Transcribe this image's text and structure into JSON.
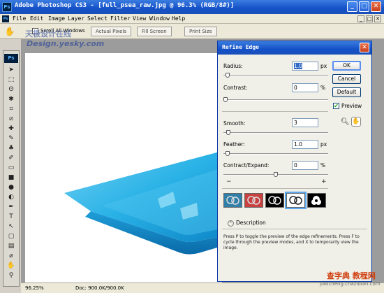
{
  "window": {
    "title": "Adobe Photoshop CS3 - [full_psea_raw.jpg @ 96.3% (RGB/8#)]",
    "app_badge": "Ps",
    "min": "_",
    "max": "□",
    "close": "✕"
  },
  "menu": {
    "items": [
      "File",
      "Edit",
      "Image",
      "Layer",
      "Select",
      "Filter",
      "View",
      "Window",
      "Help"
    ]
  },
  "options_bar": {
    "tool_icon": "hand-icon",
    "scroll_all_windows": "Scroll All Windows",
    "actual_pixels": "Actual Pixels",
    "fill_screen": "Fill Screen",
    "print_size": "Print Size"
  },
  "watermark": {
    "line1": "天极设计在线",
    "line2": "Design.yesky.com"
  },
  "toolbox": {
    "badge": "Ps",
    "tools": [
      "move-icon",
      "marquee-icon",
      "lasso-icon",
      "magic-wand-icon",
      "crop-icon",
      "slice-icon",
      "healing-icon",
      "brush-icon",
      "stamp-icon",
      "history-brush-icon",
      "eraser-icon",
      "gradient-icon",
      "blur-icon",
      "dodge-icon",
      "pen-icon",
      "type-icon",
      "path-select-icon",
      "shape-icon",
      "notes-icon",
      "eyedropper-icon",
      "hand-icon",
      "zoom-icon"
    ],
    "tool_glyphs": [
      "➤",
      "⬚",
      "ʘ",
      "✱",
      "⌗",
      "⧄",
      "✚",
      "✎",
      "♣",
      "✐",
      "▭",
      "■",
      "●",
      "◐",
      "✒",
      "T",
      "↖",
      "▢",
      "▤",
      "⌀",
      "✋",
      "⚲"
    ]
  },
  "statusbar": {
    "zoom": "96.25%",
    "doc": "Doc: 900.0K/900.0K"
  },
  "dialog": {
    "title": "Refine Edge",
    "close": "✕",
    "radius": {
      "label": "Radius:",
      "value": "1.0",
      "unit": "px",
      "slider": 0.02
    },
    "contrast": {
      "label": "Contrast:",
      "value": "0",
      "unit": "%",
      "slider": 0.0
    },
    "smooth": {
      "label": "Smooth:",
      "value": "3",
      "slider": 0.03
    },
    "feather": {
      "label": "Feather:",
      "value": "1.0",
      "unit": "px",
      "slider": 0.02
    },
    "contract_expand": {
      "label": "Contract/Expand:",
      "value": "0",
      "unit": "%",
      "slider": 0.5,
      "minus": "−",
      "plus": "+"
    },
    "ok": "OK",
    "cancel": "Cancel",
    "default": "Default",
    "preview": {
      "label": "Preview",
      "checked": true
    },
    "zoom_tool": "zoom-icon",
    "hand_tool": "hand-icon",
    "modes": [
      "standard-mode",
      "quick-mask-mode",
      "on-black-mode",
      "on-white-mode",
      "mask-mode"
    ],
    "selected_mode": 3,
    "description_header": "Description",
    "description": "Press P to toggle the preview of the edge refinements. Press F to cycle through the preview modes, and X to temporarily view the image."
  },
  "site": {
    "logo": "查字典 教程网",
    "url": "jiaocheng.chazidian.com"
  },
  "colors": {
    "titlebar": "#1451c8",
    "accent": "#316ac5",
    "ui_face": "#ece9d8",
    "workspace": "#9c9c9c",
    "object_blue": "#1aa8e0"
  }
}
